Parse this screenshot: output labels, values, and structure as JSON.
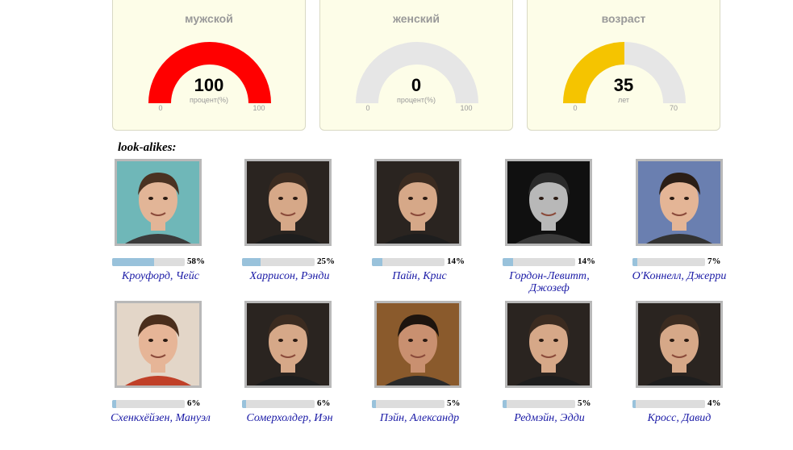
{
  "gauges": [
    {
      "id": "male",
      "title": "мужской",
      "value": "100",
      "unit": "процент(%)",
      "min": "0",
      "max": "100",
      "fraction": 1.0,
      "color": "#ff0000"
    },
    {
      "id": "female",
      "title": "женский",
      "value": "0",
      "unit": "процент(%)",
      "min": "0",
      "max": "100",
      "fraction": 0.0,
      "color": "#ff0000"
    },
    {
      "id": "age",
      "title": "возраст",
      "value": "35",
      "unit": "лет",
      "min": "0",
      "max": "70",
      "fraction": 0.5,
      "color": "#f5c400"
    }
  ],
  "lookalikes": {
    "label": "look-alikes:",
    "items": [
      {
        "name": "Кроуфорд, Чейс",
        "percent": "58%",
        "fraction": 0.58,
        "photo": "face-photo-teal"
      },
      {
        "name": "Харрисон, Рэнди",
        "percent": "25%",
        "fraction": 0.25,
        "photo": "face-photo-dark"
      },
      {
        "name": "Пайн, Крис",
        "percent": "14%",
        "fraction": 0.14,
        "photo": "face-photo-dark"
      },
      {
        "name": "Гордон-Левитт, Джозеф",
        "percent": "14%",
        "fraction": 0.14,
        "photo": "face-photo-bw"
      },
      {
        "name": "О'Коннелл, Джерри",
        "percent": "7%",
        "fraction": 0.07,
        "photo": "face-photo-blue"
      },
      {
        "name": "Схенкхёйзен, Мануэл",
        "percent": "6%",
        "fraction": 0.06,
        "photo": "face-photo-beige"
      },
      {
        "name": "Сомерхолдер, Иэн",
        "percent": "6%",
        "fraction": 0.06,
        "photo": "face-photo-dark"
      },
      {
        "name": "Пэйн, Александр",
        "percent": "5%",
        "fraction": 0.05,
        "photo": "face-photo-brown"
      },
      {
        "name": "Редмэйн, Эдди",
        "percent": "5%",
        "fraction": 0.05,
        "photo": "face-photo-dark"
      },
      {
        "name": "Кросс, Давид",
        "percent": "4%",
        "fraction": 0.04,
        "photo": "face-photo-dark"
      }
    ]
  },
  "colors": {
    "accent_bar": "#99c2db",
    "name_link": "#1a1aa6",
    "panel_bg": "#fdfde8"
  }
}
